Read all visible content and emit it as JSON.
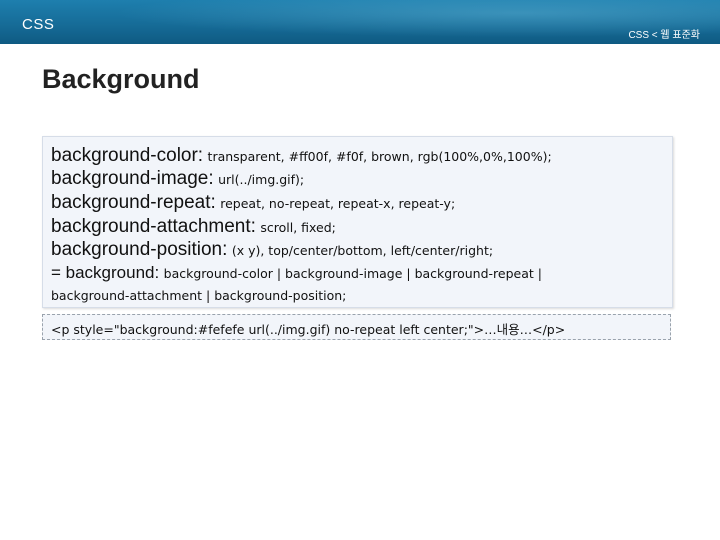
{
  "header": {
    "title": "CSS",
    "breadcrumb": "CSS < 웹 표준화"
  },
  "slide": {
    "heading": "Background"
  },
  "properties": [
    {
      "name": "background-color:",
      "value": "transparent, #ff00f, #f0f, brown, rgb(100%,0%,100%);"
    },
    {
      "name": "background-image:",
      "value": "url(../img.gif);"
    },
    {
      "name": "background-repeat:",
      "value": "repeat, no-repeat, repeat-x, repeat-y;"
    },
    {
      "name": "background-attachment:",
      "value": "scroll, fixed;"
    },
    {
      "name": "background-position:",
      "value": "(x y), top/center/bottom, left/center/right;"
    }
  ],
  "shorthand": {
    "prefix": "= background:",
    "line1": "background-color | background-image | background-repeat |",
    "line2": "background-attachment | background-position;"
  },
  "example": {
    "code": "<p style=\"background:#fefefe url(../img.gif) no-repeat left center;\">…내용…</p>"
  },
  "colors": {
    "header_bar": "#166c98",
    "panel_bg": "#f2f5fa"
  }
}
